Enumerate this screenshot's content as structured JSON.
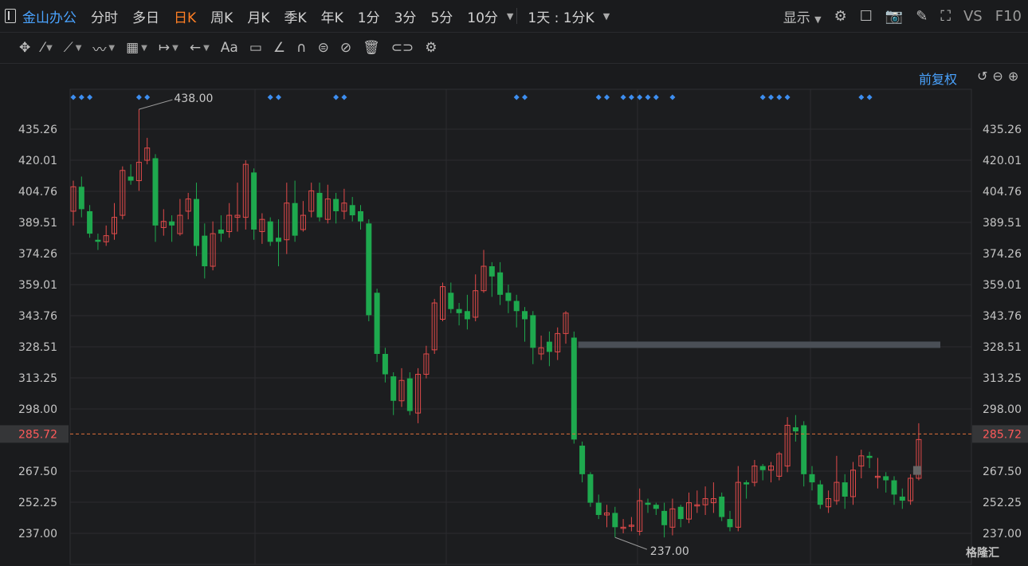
{
  "toolbar": {
    "brand": "金山办公",
    "periods": [
      "分时",
      "多日",
      "日K",
      "周K",
      "月K",
      "季K",
      "年K",
      "1分",
      "3分",
      "5分",
      "10分"
    ],
    "active_period": "日K",
    "interval_select": "1天 : 1分K",
    "display_label": "显示",
    "vs_label": "VS",
    "f10_label": "F10"
  },
  "drawing_tools": [
    "crosshair-icon",
    "line-icon",
    "polyline-icon",
    "wave-icon",
    "grid-icon",
    "range-icon",
    "arrow-icon",
    "text-icon",
    "comment-icon",
    "ruler-icon",
    "magnet-icon",
    "lock-icon",
    "eye-off-icon",
    "trash-icon",
    "compare-icon",
    "settings-icon"
  ],
  "text_tool_label": "Aa",
  "adjust_label": "前复权",
  "watermark": "格隆汇",
  "colors": {
    "up": "#e04a4a",
    "down": "#1ea94e",
    "accent": "#4aa3ff",
    "active": "#ff7f24",
    "grid": "#2b2c2f"
  },
  "chart_data": {
    "type": "candlestick",
    "ylim": [
      237.0,
      435.26
    ],
    "yticks": [
      "435.26",
      "420.01",
      "404.76",
      "389.51",
      "374.26",
      "359.01",
      "343.76",
      "328.51",
      "313.25",
      "298.00",
      "267.50",
      "252.25",
      "237.00"
    ],
    "current_price": "285.72",
    "max_label": "438.00",
    "min_label": "237.00",
    "resistance_level": 329.5,
    "candles": [
      [
        395,
        407,
        388,
        410
      ],
      [
        407,
        396,
        392,
        412
      ],
      [
        395,
        384,
        382,
        398
      ],
      [
        381,
        380,
        376,
        384
      ],
      [
        380,
        383,
        378,
        388
      ],
      [
        384,
        392,
        381,
        399
      ],
      [
        393,
        415,
        391,
        417
      ],
      [
        412,
        410,
        408,
        418
      ],
      [
        410,
        419,
        405,
        445
      ],
      [
        420,
        426,
        418,
        431
      ],
      [
        421,
        388,
        380,
        423
      ],
      [
        387,
        390,
        383,
        396
      ],
      [
        390,
        388,
        380,
        393
      ],
      [
        384,
        393,
        383,
        401
      ],
      [
        395,
        401,
        391,
        404
      ],
      [
        401,
        378,
        373,
        409
      ],
      [
        383,
        368,
        362,
        389
      ],
      [
        368,
        384,
        366,
        390
      ],
      [
        386,
        384,
        380,
        393
      ],
      [
        385,
        393,
        382,
        399
      ],
      [
        392,
        393,
        385,
        409
      ],
      [
        392,
        418,
        386,
        420
      ],
      [
        414,
        386,
        381,
        416
      ],
      [
        385,
        391,
        379,
        394
      ],
      [
        390,
        380,
        378,
        392
      ],
      [
        382,
        380,
        368,
        391
      ],
      [
        381,
        399,
        374,
        409
      ],
      [
        399,
        383,
        380,
        410
      ],
      [
        386,
        393,
        385,
        400
      ],
      [
        395,
        405,
        392,
        409
      ],
      [
        404,
        392,
        390,
        409
      ],
      [
        391,
        401,
        389,
        408
      ],
      [
        401,
        395,
        389,
        404
      ],
      [
        395,
        399,
        391,
        406
      ],
      [
        398,
        393,
        390,
        402
      ],
      [
        395,
        390,
        386,
        398
      ],
      [
        389,
        344,
        341,
        391
      ],
      [
        355,
        325,
        321,
        357
      ],
      [
        325,
        315,
        311,
        328
      ],
      [
        314,
        302,
        295,
        316
      ],
      [
        302,
        312,
        299,
        318
      ],
      [
        313,
        297,
        295,
        316
      ],
      [
        296,
        315,
        291,
        318
      ],
      [
        315,
        325,
        313,
        329
      ],
      [
        327,
        350,
        325,
        352
      ],
      [
        342,
        358,
        341,
        360
      ],
      [
        355,
        347,
        345,
        360
      ],
      [
        347,
        345,
        339,
        350
      ],
      [
        346,
        342,
        337,
        354
      ],
      [
        343,
        356,
        341,
        364
      ],
      [
        356,
        368,
        355,
        376
      ],
      [
        368,
        363,
        353,
        370
      ],
      [
        365,
        354,
        349,
        370
      ],
      [
        355,
        351,
        345,
        359
      ],
      [
        351,
        346,
        338,
        354
      ],
      [
        346,
        342,
        331,
        348
      ],
      [
        344,
        328,
        320,
        346
      ],
      [
        325,
        328,
        322,
        334
      ],
      [
        331,
        326,
        319,
        336
      ],
      [
        326,
        335,
        322,
        338
      ],
      [
        335,
        345,
        330,
        346
      ],
      [
        333,
        283,
        281,
        336
      ],
      [
        280,
        266,
        262,
        282
      ],
      [
        266,
        252,
        250,
        267
      ],
      [
        252,
        246,
        244,
        256
      ],
      [
        246,
        247,
        240,
        251
      ],
      [
        247,
        240,
        235,
        250
      ],
      [
        240,
        240,
        237,
        244
      ],
      [
        241,
        241,
        238,
        245
      ],
      [
        238,
        253,
        236,
        259
      ],
      [
        252,
        251,
        247,
        254
      ],
      [
        251,
        249,
        246,
        252
      ],
      [
        248,
        241,
        235,
        252
      ],
      [
        240,
        249,
        236,
        254
      ],
      [
        250,
        244,
        240,
        251
      ],
      [
        244,
        252,
        242,
        257
      ],
      [
        251,
        251,
        247,
        258
      ],
      [
        251,
        254,
        246,
        260
      ],
      [
        252,
        254,
        247,
        262
      ],
      [
        255,
        245,
        243,
        257
      ],
      [
        244,
        240,
        238,
        248
      ],
      [
        240,
        262,
        238,
        270
      ],
      [
        262,
        261,
        254,
        263
      ],
      [
        262,
        270,
        260,
        273
      ],
      [
        270,
        268,
        263,
        271
      ],
      [
        268,
        270,
        262,
        272
      ],
      [
        265,
        276,
        263,
        277
      ],
      [
        270,
        290,
        267,
        294
      ],
      [
        289,
        287,
        282,
        295
      ],
      [
        290,
        266,
        260,
        292
      ],
      [
        266,
        262,
        258,
        270
      ],
      [
        261,
        251,
        249,
        263
      ],
      [
        250,
        254,
        247,
        258
      ],
      [
        253,
        262,
        251,
        275
      ],
      [
        262,
        255,
        249,
        266
      ],
      [
        255,
        268,
        251,
        272
      ],
      [
        270,
        275,
        264,
        278
      ],
      [
        275,
        274,
        269,
        277
      ],
      [
        265,
        265,
        259,
        274
      ],
      [
        265,
        263,
        257,
        267
      ],
      [
        263,
        256,
        251,
        265
      ],
      [
        255,
        253,
        249,
        259
      ],
      [
        253,
        264,
        251,
        266
      ],
      [
        264,
        283,
        263,
        291
      ]
    ],
    "annotations": [
      [
        0,
        1,
        2
      ],
      [
        8,
        9
      ],
      [
        24,
        25
      ],
      [
        32,
        33
      ],
      [
        54,
        55
      ],
      [
        64,
        65
      ],
      [
        67,
        68,
        69,
        70,
        71
      ],
      [
        73
      ],
      [
        84,
        85,
        86,
        87
      ],
      [
        96,
        97
      ]
    ]
  }
}
